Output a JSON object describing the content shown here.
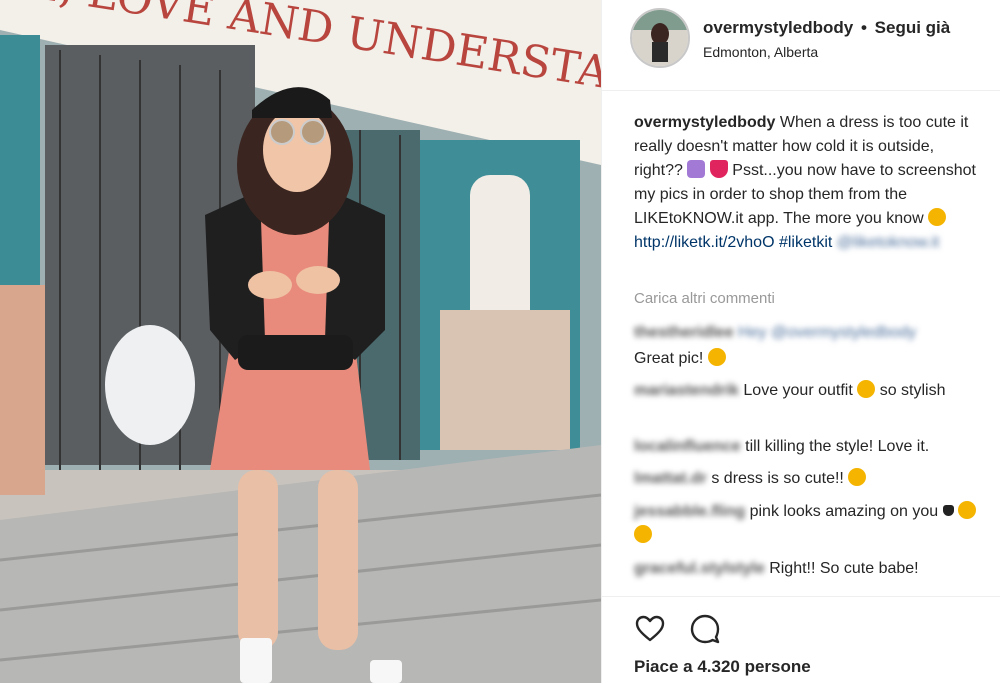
{
  "post": {
    "username": "overmystyledbody",
    "separator": "•",
    "follow_label": "Segui già",
    "location": "Edmonton, Alberta",
    "photo_sign_text": "E, LOVE AND UNDERSTANDING ?"
  },
  "caption": {
    "username": "overmystyledbody",
    "text_1": "When a dress is too cute it really doesn't matter how cold it is outside, right??",
    "text_2": "Psst...you now have to screenshot my pics in order to shop them from the LIKEtoKNOW.it app. The more you know",
    "link": "http://liketk.it/2vhoO",
    "hashtag": "#liketkit",
    "mention": "@liketoknow.it"
  },
  "load_more_label": "Carica altri commenti",
  "comments": [
    {
      "user": "thestheridlee",
      "mention": "Hey @overmystyledbody",
      "text": "Great pic!"
    },
    {
      "user": "mariastendrik",
      "text": "Love your outfit",
      "text_after": "so stylish"
    },
    {
      "user": "localinfluence",
      "text": "till killing the style! Love it."
    },
    {
      "user": "lmattat.dr",
      "text": "s dress is so cute!!"
    },
    {
      "user": "jessabble.fling",
      "text": "pink looks amazing on you"
    },
    {
      "user": "graceful.stylstyle",
      "text": "Right!! So cute babe!"
    }
  ],
  "actions": {
    "likes_text": "Piace a 4.320 persone",
    "like_icon": "heart-icon",
    "comment_icon": "comment-icon"
  },
  "colors": {
    "link": "#003569",
    "text": "#262626",
    "muted": "#999999",
    "border": "#efefef"
  }
}
